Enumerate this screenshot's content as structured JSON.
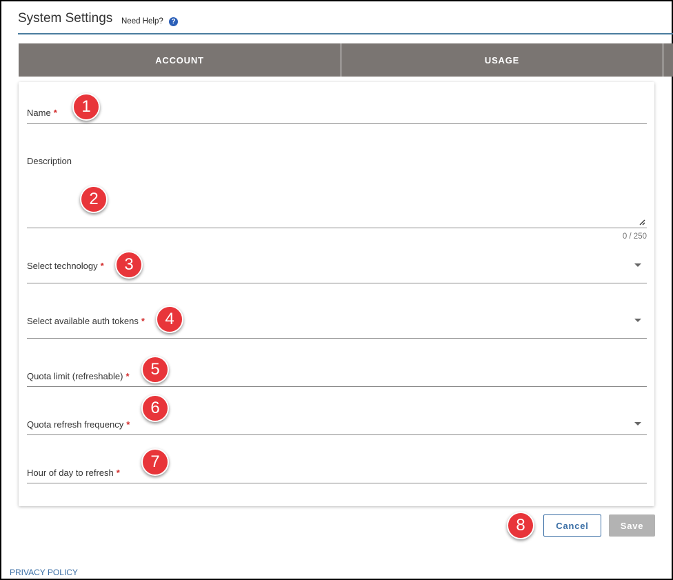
{
  "header": {
    "title": "System Settings",
    "help_text": "Need Help?",
    "help_icon": "help-circle-icon"
  },
  "tabs": [
    {
      "label": "ACCOUNT"
    },
    {
      "label": "USAGE"
    }
  ],
  "form": {
    "name": {
      "label": "Name",
      "required": "*",
      "value": ""
    },
    "description": {
      "label": "Description",
      "value": "",
      "counter": "0 / 250"
    },
    "technology": {
      "label": "Select technology",
      "required": "*",
      "value": ""
    },
    "auth_tokens": {
      "label": "Select available auth tokens",
      "required": "*",
      "value": ""
    },
    "quota_limit": {
      "label": "Quota limit (refreshable)",
      "required": "*",
      "value": ""
    },
    "quota_frequency": {
      "label": "Quota refresh frequency",
      "required": "*",
      "value": ""
    },
    "refresh_hour": {
      "label": "Hour of day to refresh",
      "required": "*",
      "value": ""
    }
  },
  "markers": [
    "1",
    "2",
    "3",
    "4",
    "5",
    "6",
    "7",
    "8"
  ],
  "actions": {
    "cancel_label": "Cancel",
    "save_label": "Save"
  },
  "footer": {
    "privacy_label": "PRIVACY POLICY"
  },
  "colors": {
    "tab_bar": "#7a7572",
    "header_rule": "#4a7d9e",
    "required": "#d32f2f",
    "marker": "#e8353a",
    "link": "#3a6ea5",
    "save_disabled": "#b3b3b3"
  }
}
